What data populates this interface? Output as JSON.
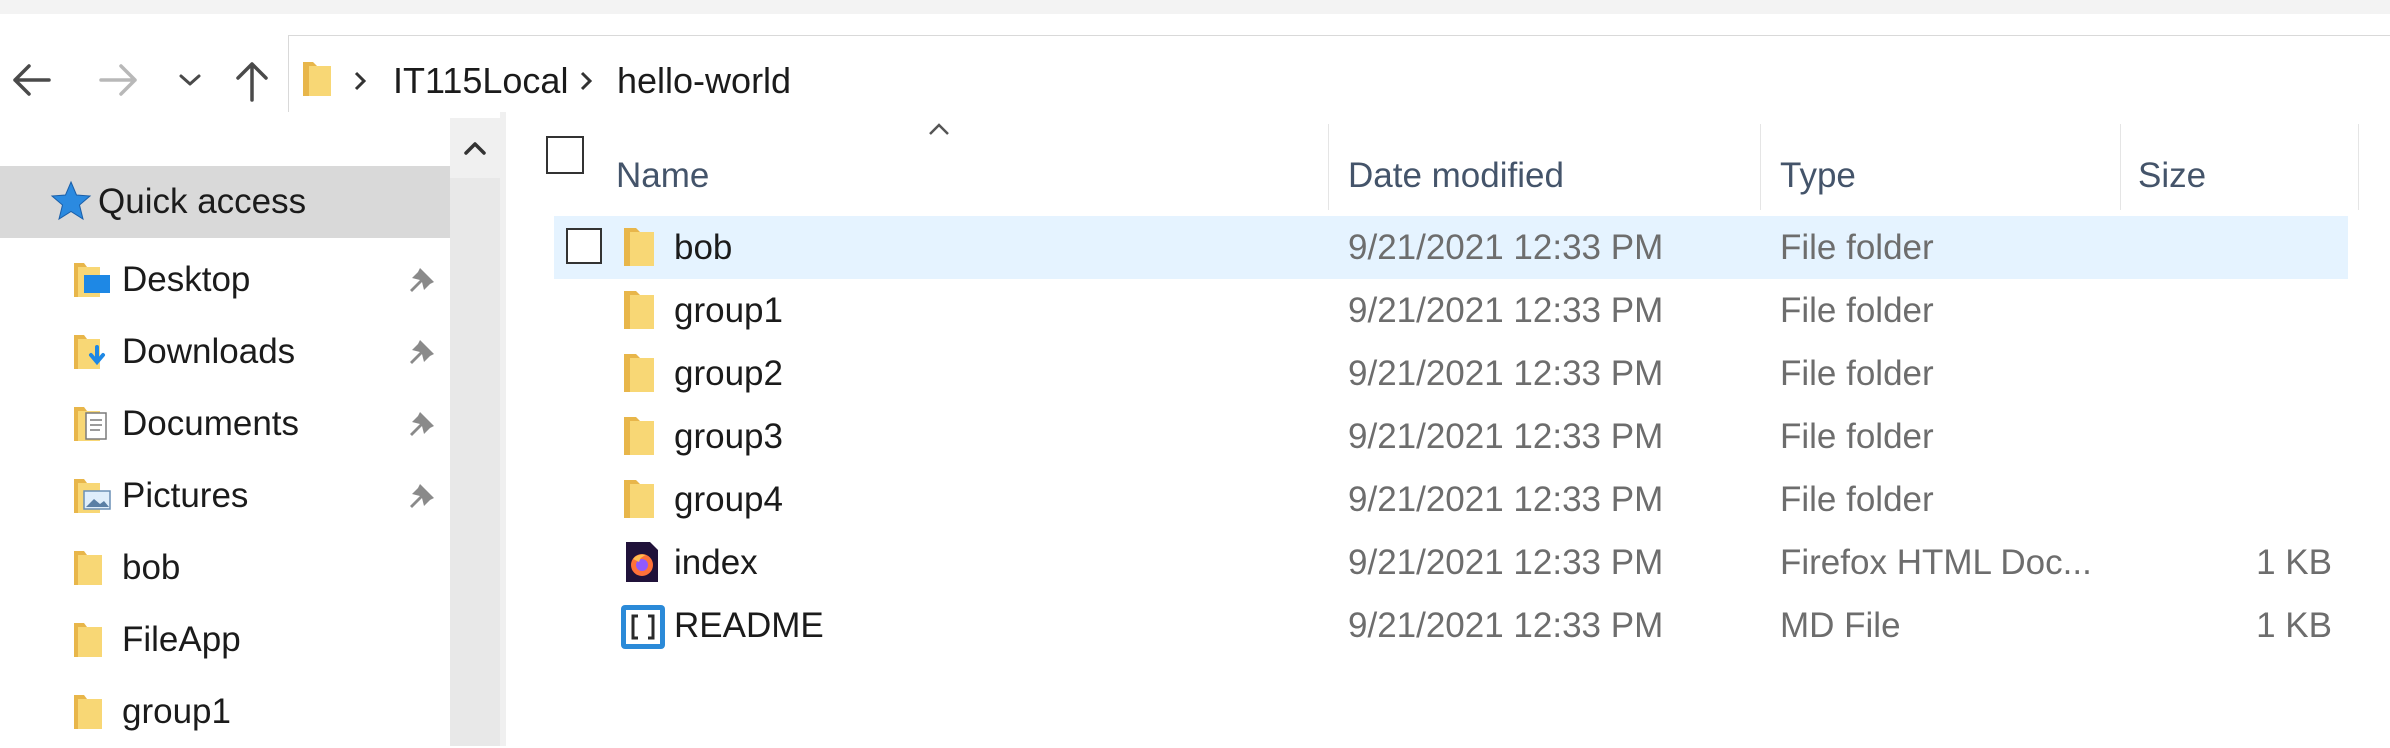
{
  "navigation": {
    "back": "back-arrow-icon",
    "forward": "forward-arrow-icon",
    "recent": "chevron-down-icon",
    "up": "up-arrow-icon"
  },
  "address_bar": {
    "crumbs": [
      "IT115Local",
      "hello-world"
    ]
  },
  "nav_pane": {
    "quick_access": "Quick access",
    "items": [
      {
        "label": "Desktop",
        "icon": "desktop-folder-icon",
        "pinned": true
      },
      {
        "label": "Downloads",
        "icon": "downloads-folder-icon",
        "pinned": true
      },
      {
        "label": "Documents",
        "icon": "documents-folder-icon",
        "pinned": true
      },
      {
        "label": "Pictures",
        "icon": "pictures-folder-icon",
        "pinned": true
      },
      {
        "label": "bob",
        "icon": "folder-icon",
        "pinned": false
      },
      {
        "label": "FileApp",
        "icon": "folder-icon",
        "pinned": false
      },
      {
        "label": "group1",
        "icon": "folder-icon",
        "pinned": false
      }
    ]
  },
  "file_list": {
    "columns": {
      "name": "Name",
      "date": "Date modified",
      "type": "Type",
      "size": "Size"
    },
    "sort_indicator": "sort-ascending-icon",
    "rows": [
      {
        "name": "bob",
        "date": "9/21/2021 12:33 PM",
        "type": "File folder",
        "size": "",
        "icon": "folder-icon",
        "selected": true
      },
      {
        "name": "group1",
        "date": "9/21/2021 12:33 PM",
        "type": "File folder",
        "size": "",
        "icon": "folder-icon",
        "selected": false
      },
      {
        "name": "group2",
        "date": "9/21/2021 12:33 PM",
        "type": "File folder",
        "size": "",
        "icon": "folder-icon",
        "selected": false
      },
      {
        "name": "group3",
        "date": "9/21/2021 12:33 PM",
        "type": "File folder",
        "size": "",
        "icon": "folder-icon",
        "selected": false
      },
      {
        "name": "group4",
        "date": "9/21/2021 12:33 PM",
        "type": "File folder",
        "size": "",
        "icon": "folder-icon",
        "selected": false
      },
      {
        "name": "index",
        "date": "9/21/2021 12:33 PM",
        "type": "Firefox HTML Doc...",
        "size": "1 KB",
        "icon": "firefox-html-icon",
        "selected": false
      },
      {
        "name": "README",
        "date": "9/21/2021 12:33 PM",
        "type": "MD File",
        "size": "1 KB",
        "icon": "brackets-file-icon",
        "selected": false
      }
    ]
  },
  "colors": {
    "selected_row": "#e5f3ff",
    "quick_access_bg": "#d9d9d9",
    "folder_yellow": "#f8d775",
    "header_text": "#44546a"
  }
}
